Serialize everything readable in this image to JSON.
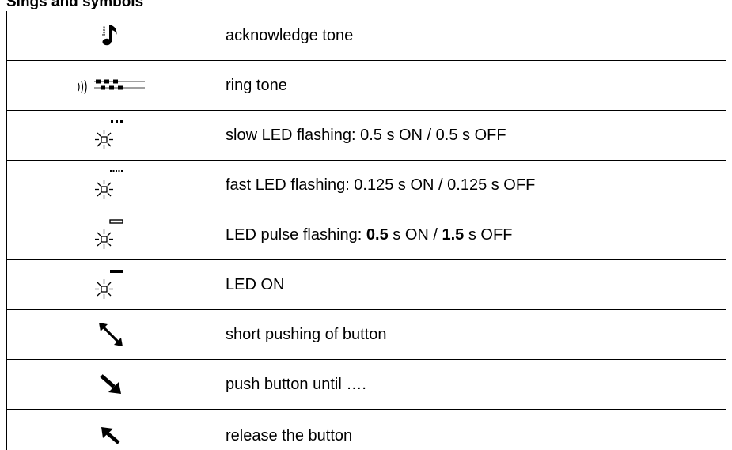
{
  "page": {
    "heading": "Sings and symbols"
  },
  "rows": [
    {
      "icon": "beep-note-icon",
      "description": "acknowledge tone"
    },
    {
      "icon": "ring-tone-icon",
      "description": "ring tone"
    },
    {
      "icon": "led-slow-flash-icon",
      "description": "slow LED flashing: 0.5 s ON / 0.5 s OFF"
    },
    {
      "icon": "led-fast-flash-icon",
      "description": "fast LED flashing: 0.125 s ON / 0.125 s OFF"
    },
    {
      "icon": "led-pulse-flash-icon",
      "description_parts": [
        "LED pulse flashing: ",
        "0.5",
        " s ON / ",
        "1.5",
        " s OFF"
      ]
    },
    {
      "icon": "led-on-icon",
      "description": "LED ON"
    },
    {
      "icon": "short-push-arrows-icon",
      "description": "short pushing of button"
    },
    {
      "icon": "push-arrow-icon",
      "description": "push button until …."
    },
    {
      "icon": "release-arrow-icon",
      "description": "release the button"
    }
  ]
}
